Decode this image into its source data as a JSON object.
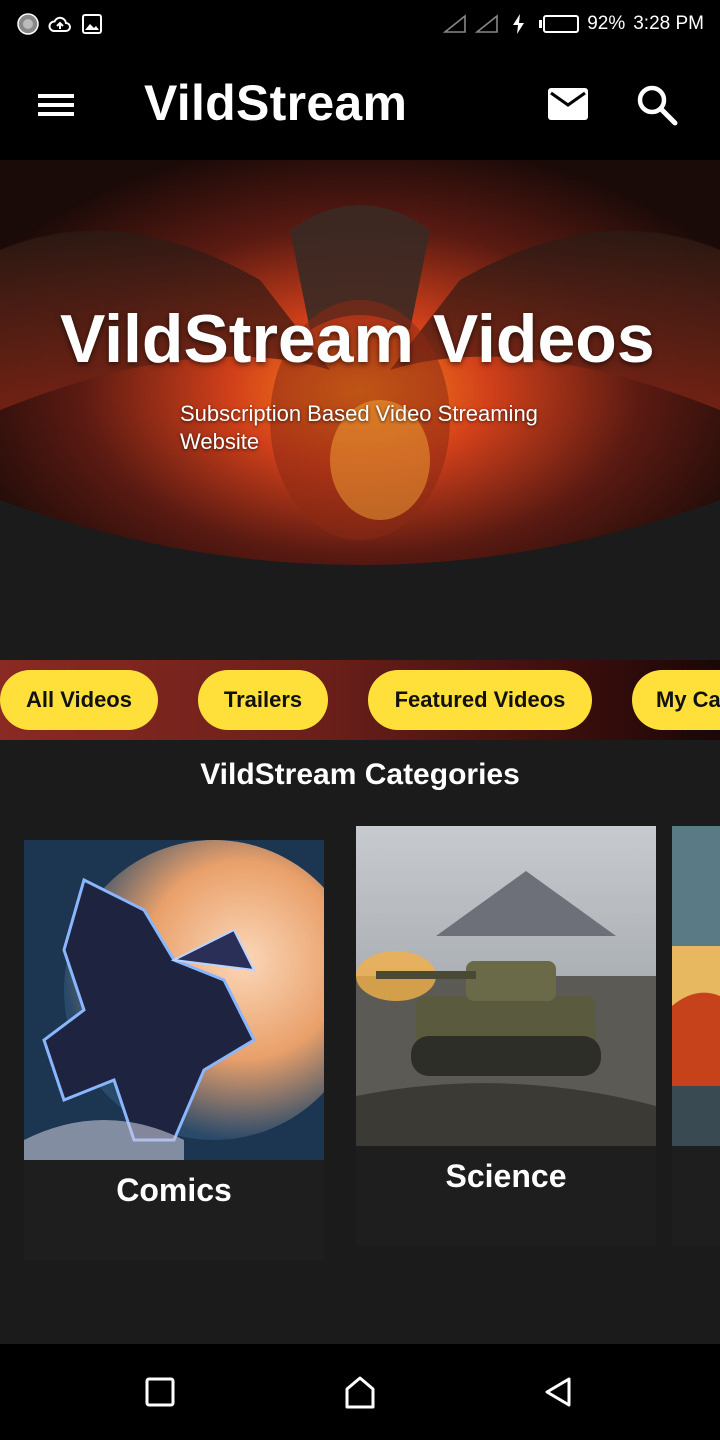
{
  "status_bar": {
    "battery_percent": "92%",
    "time": "3:28 PM",
    "icons_left": [
      "loading-icon",
      "cloud-upload-icon",
      "image-icon"
    ],
    "icons_right": [
      "signal-icon",
      "signal-icon",
      "charging-icon",
      "battery-icon"
    ],
    "battery_level": 0.92
  },
  "app_bar": {
    "title": "VildStream",
    "icons": [
      "menu-icon",
      "mail-icon",
      "search-icon"
    ]
  },
  "hero": {
    "title": "VildStream Videos",
    "subtitle": "Subscription Based Video Streaming Website"
  },
  "chips": [
    {
      "label": "All Videos"
    },
    {
      "label": "Trailers"
    },
    {
      "label": "Featured Videos"
    },
    {
      "label": "My Ca"
    }
  ],
  "categories_section": {
    "title": "VildStream Categories",
    "items": [
      {
        "label": "Comics"
      },
      {
        "label": "Science"
      },
      {
        "label": ""
      }
    ]
  },
  "nav_bar": {
    "icons": [
      "recents-icon",
      "home-icon",
      "back-icon"
    ]
  },
  "colors": {
    "chip_bg": "#ffe03a",
    "background": "#1b1b1b",
    "bar": "#000000",
    "battery": "#22c55e"
  }
}
